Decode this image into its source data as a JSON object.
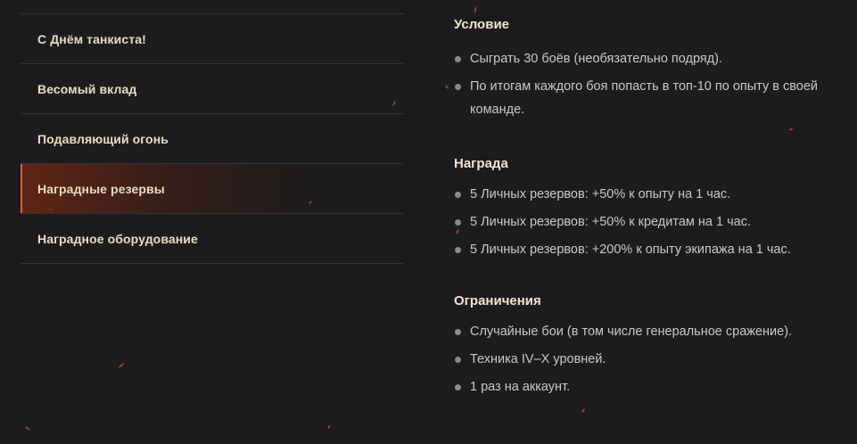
{
  "menu": {
    "items": [
      {
        "label": "С Днём танкиста!"
      },
      {
        "label": "Весомый вклад"
      },
      {
        "label": "Подавляющий огонь"
      },
      {
        "label": "Наградные резервы"
      },
      {
        "label": "Наградное оборудование"
      }
    ]
  },
  "sections": [
    {
      "title": "Условие",
      "items": [
        "Сыграть 30 боёв (необязательно подряд).",
        "По итогам каждого боя попасть в топ-10 по опыту в своей команде."
      ]
    },
    {
      "title": "Награда",
      "items": [
        "5 Личных резервов: +50% к опыту на 1 час.",
        "5 Личных резервов: +50% к кредитам на 1 час.",
        "5 Личных резервов: +200% к опыту экипажа на 1 час."
      ]
    },
    {
      "title": "Ограничения",
      "items": [
        "Случайные бои (в том числе генеральное сражение).",
        "Техника IV–X уровней.",
        "1 раз на аккаунт."
      ]
    }
  ],
  "colors": {
    "background": "#1c1c1e",
    "accent": "#e0602e",
    "menu_text": "#e8dcc0",
    "body_text": "#c9c9c9"
  }
}
